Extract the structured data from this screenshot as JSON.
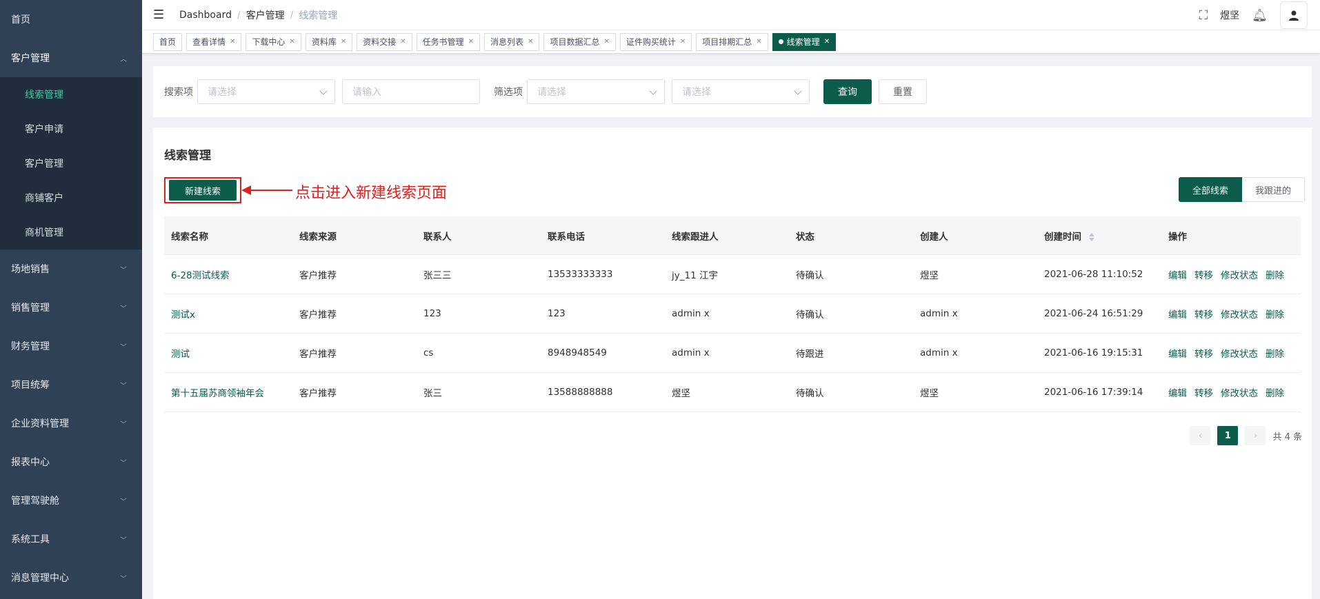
{
  "sidebar": {
    "items": [
      {
        "label": "首页"
      },
      {
        "label": "客户管理"
      },
      {
        "label": "场地销售"
      },
      {
        "label": "销售管理"
      },
      {
        "label": "财务管理"
      },
      {
        "label": "项目统筹"
      },
      {
        "label": "企业资料管理"
      },
      {
        "label": "报表中心"
      },
      {
        "label": "管理驾驶舱"
      },
      {
        "label": "系统工具"
      },
      {
        "label": "消息管理中心"
      }
    ],
    "submenu": [
      {
        "label": "线索管理"
      },
      {
        "label": "客户申请"
      },
      {
        "label": "客户管理"
      },
      {
        "label": "商铺客户"
      },
      {
        "label": "商机管理"
      }
    ]
  },
  "navbar": {
    "breadcrumb": [
      "Dashboard",
      "客户管理",
      "线索管理"
    ],
    "username": "煜坚"
  },
  "tags": [
    {
      "label": "首页"
    },
    {
      "label": "查看详情"
    },
    {
      "label": "下载中心"
    },
    {
      "label": "资料库"
    },
    {
      "label": "资料交接"
    },
    {
      "label": "任务书管理"
    },
    {
      "label": "消息列表"
    },
    {
      "label": "项目数据汇总"
    },
    {
      "label": "证件购买统计"
    },
    {
      "label": "项目排期汇总"
    },
    {
      "label": "线索管理"
    }
  ],
  "search": {
    "label1": "搜索项",
    "select1_placeholder": "请选择",
    "input_placeholder": "请输入",
    "label2": "筛选项",
    "select2_placeholder": "请选择",
    "select3_placeholder": "请选择",
    "query_label": "查询",
    "reset_label": "重置"
  },
  "list": {
    "title": "线索管理",
    "new_label": "新建线索",
    "annotation": "点击进入新建线索页面",
    "toggle_all": "全部线索",
    "toggle_mine": "我跟进的"
  },
  "table": {
    "headers": [
      "线索名称",
      "线索来源",
      "联系人",
      "联系电话",
      "线索跟进人",
      "状态",
      "创建人",
      "创建时间",
      "操作"
    ],
    "rows": [
      {
        "name": "6-28测试线索",
        "source": "客户推荐",
        "contact": "张三三",
        "phone": "13533333333",
        "follower": "jy_11 江宇",
        "status": "待确认",
        "creator": "煜坚",
        "time": "2021-06-28 11:10:52"
      },
      {
        "name": "测试x",
        "source": "客户推荐",
        "contact": "123",
        "phone": "123",
        "follower": "admin x",
        "status": "待确认",
        "creator": "admin x",
        "time": "2021-06-24 16:51:29"
      },
      {
        "name": "测试",
        "source": "客户推荐",
        "contact": "cs",
        "phone": "8948948549",
        "follower": "admin x",
        "status": "待跟进",
        "creator": "admin x",
        "time": "2021-06-16 19:15:31"
      },
      {
        "name": "第十五届苏商领袖年会",
        "source": "客户推荐",
        "contact": "张三",
        "phone": "13588888888",
        "follower": "煜坚",
        "status": "待确认",
        "creator": "煜坚",
        "time": "2021-06-16 17:39:14"
      }
    ],
    "ops": [
      "编辑",
      "转移",
      "修改状态",
      "删除"
    ]
  },
  "pagination": {
    "current": "1",
    "total": "共 4 条"
  },
  "colors": {
    "primary": "#0b5c4a",
    "sidebar": "#304156",
    "annotation": "#e02020"
  }
}
